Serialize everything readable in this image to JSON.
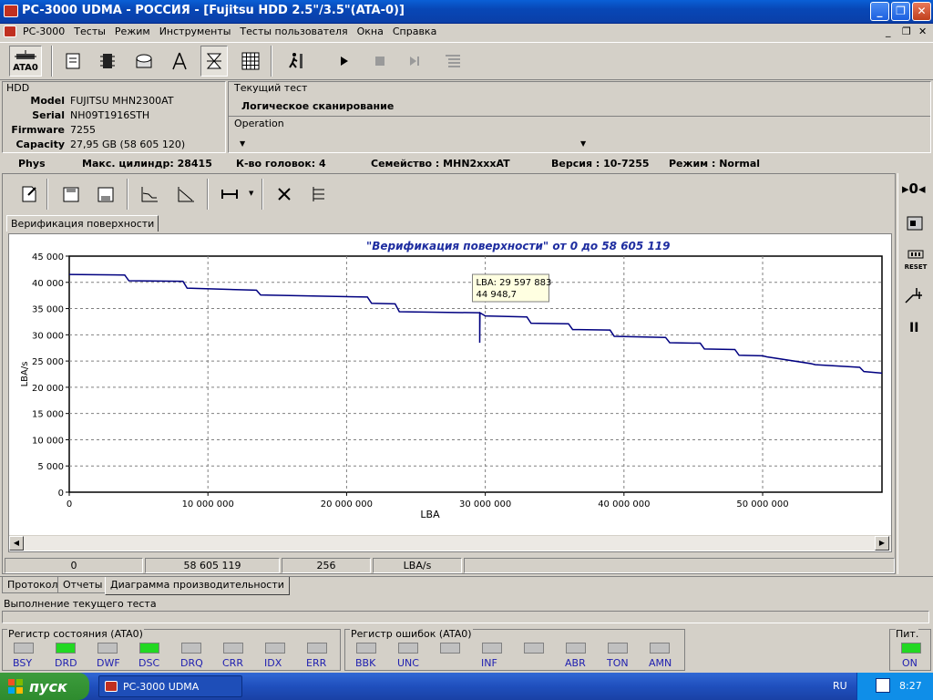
{
  "window": {
    "title": "PC-3000 UDMA - РОССИЯ - [Fujitsu HDD 2.5\"/3.5\"(ATA-0)]"
  },
  "menu": {
    "items": [
      "PC-3000",
      "Тесты",
      "Режим",
      "Инструменты",
      "Тесты пользователя",
      "Окна",
      "Справка"
    ]
  },
  "toolbar": {
    "ata_label": "ATA0"
  },
  "hdd": {
    "group_label": "HDD",
    "model_label": "Model",
    "model": "FUJITSU MHN2300AT",
    "serial_label": "Serial",
    "serial": "NH09T1916STH",
    "firmware_label": "Firmware",
    "firmware": "7255",
    "capacity_label": "Capacity",
    "capacity": "27,95 GB (58 605 120)"
  },
  "test": {
    "group_label": "Текущий тест",
    "name": "Логическое сканирование",
    "operation_label": "Operation"
  },
  "infobar": {
    "phys": "Phys",
    "cyl": "Макс. цилиндр: 28415",
    "heads": "К-во головок: 4",
    "family": "Семейство : MHN2xxxAT",
    "version": "Версия : 10-7255",
    "mode": "Режим : Normal"
  },
  "doc_tab": "Верификация поверхности",
  "side": {
    "reset_label": "RESET"
  },
  "chart_data": {
    "type": "line",
    "title": "\"Верификация поверхности\" от 0 до 58 605 119",
    "xlabel": "LBA",
    "ylabel": "LBA/s",
    "xlim": [
      0,
      58605119
    ],
    "ylim": [
      0,
      45000
    ],
    "x_ticks": [
      "0",
      "10 000 000",
      "20 000 000",
      "30 000 000",
      "40 000 000",
      "50 000 000"
    ],
    "x_tick_values": [
      0,
      10000000,
      20000000,
      30000000,
      40000000,
      50000000
    ],
    "y_ticks": [
      "0",
      "5 000",
      "10 000",
      "15 000",
      "20 000",
      "25 000",
      "30 000",
      "35 000",
      "40 000",
      "45 000"
    ],
    "y_tick_values": [
      0,
      5000,
      10000,
      15000,
      20000,
      25000,
      30000,
      35000,
      40000,
      45000
    ],
    "grid": true,
    "series": [
      {
        "color": "#000080",
        "x": [
          0,
          4000000,
          4300000,
          8200000,
          8500000,
          13500000,
          13800000,
          21500000,
          21800000,
          23500000,
          23800000,
          29500000,
          29597883,
          30000000,
          33000000,
          33300000,
          36000000,
          36300000,
          39000000,
          39300000,
          43000000,
          43300000,
          45500000,
          45800000,
          48000000,
          48300000,
          50000000,
          50300000,
          53500000,
          53800000,
          57000000,
          57300000,
          58605119
        ],
        "y": [
          41500,
          41400,
          40300,
          40200,
          38900,
          38500,
          37600,
          37200,
          36000,
          35900,
          34400,
          34200,
          44948.7,
          33600,
          33400,
          32200,
          32100,
          31000,
          30900,
          29700,
          29500,
          28500,
          28400,
          27300,
          27200,
          26100,
          26000,
          25800,
          24500,
          24300,
          23800,
          23000,
          22700
        ]
      }
    ],
    "tooltip": {
      "lba": "LBA: 29 597 883",
      "value": "44 948,7"
    }
  },
  "statusgrid": {
    "start": "0",
    "end": "58 605 119",
    "block": "256",
    "unit": "LBA/s"
  },
  "bottom_tabs": [
    "Протокол",
    "Отчеты",
    "Диаграмма производительности"
  ],
  "status_text": "Выполнение текущего теста",
  "status_register": {
    "label": "Регистр состояния (ATA0)",
    "items": [
      {
        "name": "BSY",
        "on": false
      },
      {
        "name": "DRD",
        "on": true
      },
      {
        "name": "DWF",
        "on": false
      },
      {
        "name": "DSC",
        "on": true
      },
      {
        "name": "DRQ",
        "on": false
      },
      {
        "name": "CRR",
        "on": false
      },
      {
        "name": "IDX",
        "on": false
      },
      {
        "name": "ERR",
        "on": false
      }
    ]
  },
  "error_register": {
    "label": "Регистр ошибок (ATA0)",
    "items": [
      {
        "name": "BBK",
        "on": false
      },
      {
        "name": "UNC",
        "on": false
      },
      {
        "name": "",
        "on": false
      },
      {
        "name": "INF",
        "on": false
      },
      {
        "name": "",
        "on": false
      },
      {
        "name": "ABR",
        "on": false
      },
      {
        "name": "TON",
        "on": false
      },
      {
        "name": "AMN",
        "on": false
      }
    ]
  },
  "power": {
    "label": "Пит.",
    "state": "ON"
  },
  "taskbar": {
    "start": "пуск",
    "task": "PC-3000 UDMA",
    "lang": "RU",
    "time": "8:27"
  }
}
